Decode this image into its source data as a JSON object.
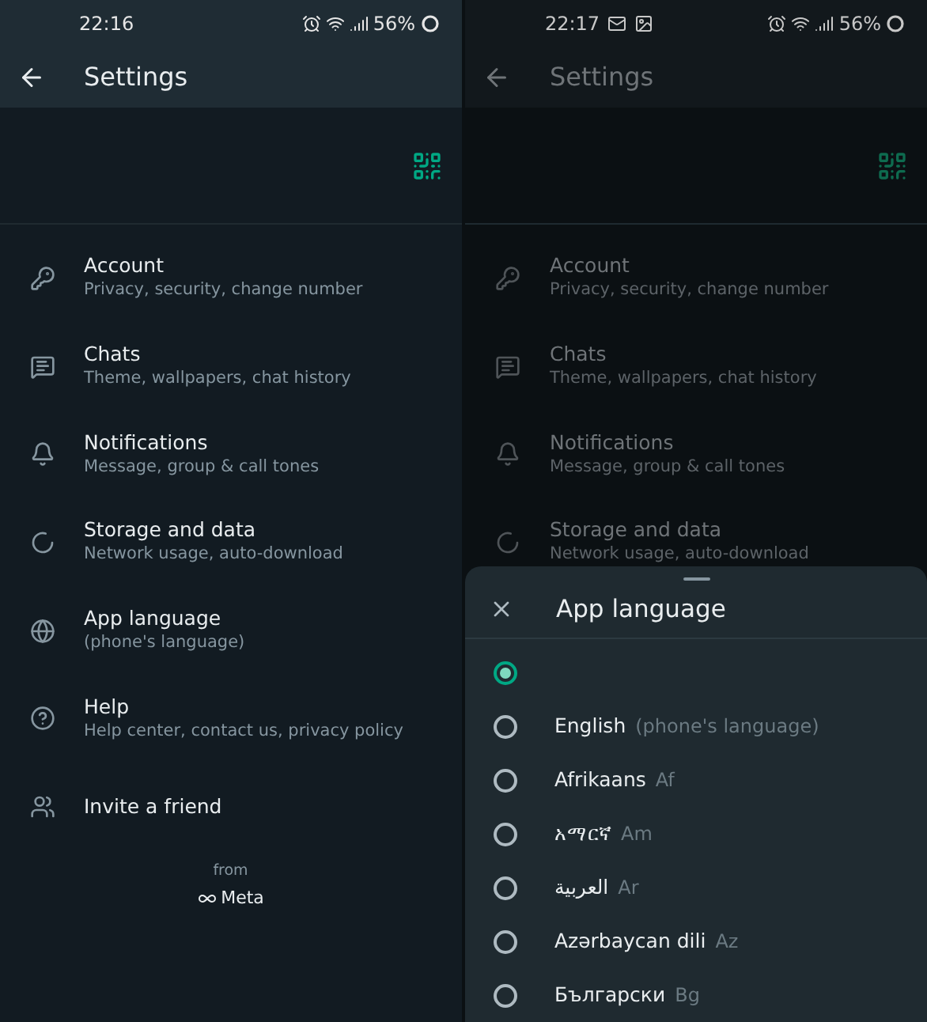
{
  "left_screen": {
    "status_bar": {
      "time": "22:16",
      "battery": "56%"
    },
    "app_bar": {
      "title": "Settings"
    },
    "items": [
      {
        "kind": "key",
        "title": "Account",
        "subtitle": "Privacy, security, change number"
      },
      {
        "kind": "chat",
        "title": "Chats",
        "subtitle": "Theme, wallpapers, chat history"
      },
      {
        "kind": "bell",
        "title": "Notifications",
        "subtitle": "Message, group & call tones"
      },
      {
        "kind": "storage",
        "title": "Storage and data",
        "subtitle": "Network usage, auto-download"
      },
      {
        "kind": "globe",
        "title": "App language",
        "subtitle": "(phone's language)"
      },
      {
        "kind": "help",
        "title": "Help",
        "subtitle": "Help center, contact us, privacy policy"
      },
      {
        "kind": "people",
        "title": "Invite a friend"
      }
    ],
    "footer": {
      "from": "from",
      "brand": "Meta"
    }
  },
  "right_screen": {
    "status_bar": {
      "time": "22:17",
      "battery": "56%",
      "notification_icons": [
        {
          "kind": "mail"
        },
        {
          "kind": "image"
        }
      ]
    },
    "app_bar": {
      "title": "Settings"
    },
    "items": [
      {
        "kind": "key",
        "title": "Account",
        "subtitle": "Privacy, security, change number"
      },
      {
        "kind": "chat",
        "title": "Chats",
        "subtitle": "Theme, wallpapers, chat history"
      },
      {
        "kind": "bell",
        "title": "Notifications",
        "subtitle": "Message, group & call tones"
      },
      {
        "kind": "storage",
        "title": "Storage and data",
        "subtitle": "Network usage, auto-download"
      }
    ],
    "sheet": {
      "title": "App language",
      "options": [
        {
          "selected": true
        },
        {
          "name": "English",
          "code": "(phone's language)",
          "selected": false
        },
        {
          "name": "Afrikaans",
          "code": "Af",
          "selected": false
        },
        {
          "name": "አማርኛ",
          "code": "Am",
          "selected": false
        },
        {
          "name": "العربية",
          "code": "Ar",
          "selected": false
        },
        {
          "name": "Azərbaycan dili",
          "code": "Az",
          "selected": false
        },
        {
          "name": "Български",
          "code": "Bg",
          "selected": false
        }
      ]
    }
  }
}
